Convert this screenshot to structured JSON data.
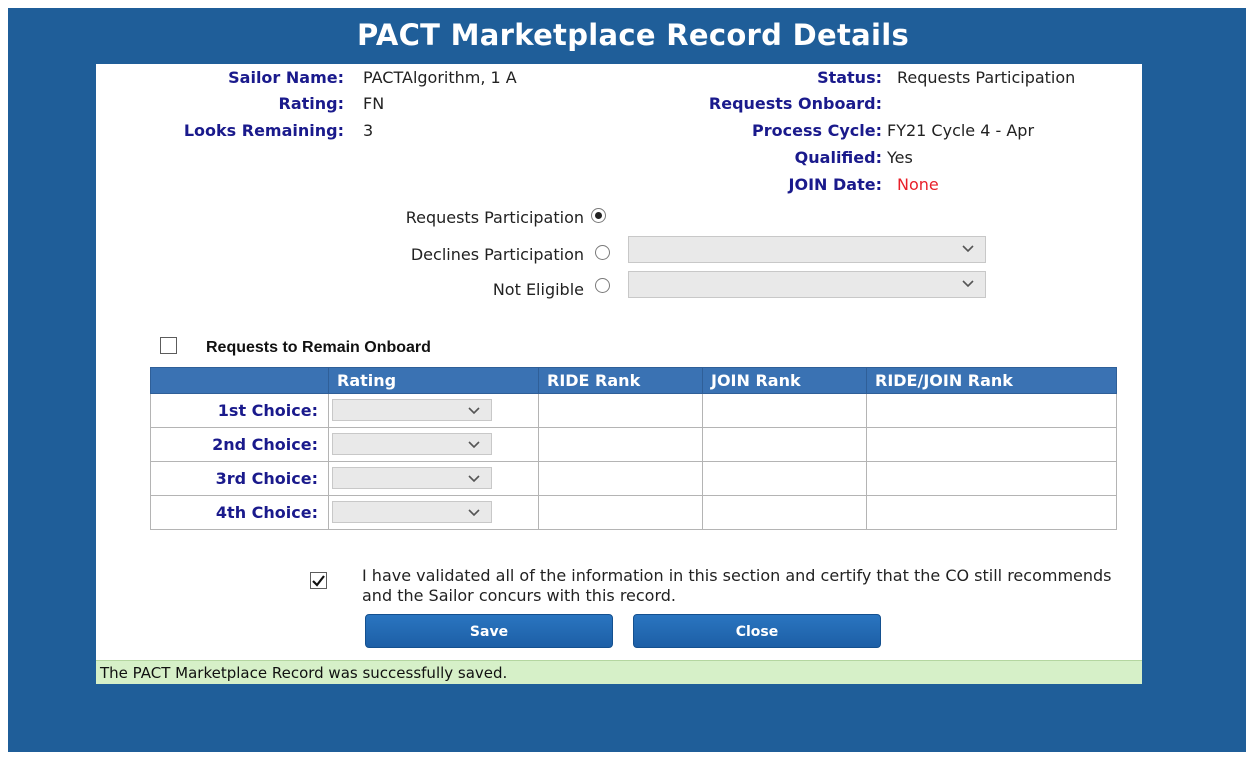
{
  "dialog": {
    "title": "PACT Marketplace Record Details"
  },
  "details": {
    "sailor_name_label": "Sailor Name:",
    "sailor_name": "PACTAlgorithm, 1 A",
    "rating_label": "Rating:",
    "rating": "FN",
    "looks_remaining_label": "Looks Remaining:",
    "looks_remaining": "3",
    "status_label": "Status:",
    "status": "Requests Participation",
    "requests_onboard_label": "Requests Onboard:",
    "requests_onboard": "",
    "process_cycle_label": "Process Cycle:",
    "process_cycle": "FY21 Cycle 4 - Apr",
    "qualified_label": "Qualified:",
    "qualified": "Yes",
    "join_date_label": "JOIN Date:",
    "join_date": "None",
    "join_date_color": "#e8202a"
  },
  "participation": {
    "options": [
      {
        "label": "Requests Participation",
        "selected": true
      },
      {
        "label": "Declines Participation",
        "selected": false
      },
      {
        "label": "Not Eligible",
        "selected": false
      }
    ]
  },
  "remain_onboard": {
    "label": "Requests to Remain Onboard",
    "checked": false
  },
  "choices_table": {
    "headers": [
      "",
      "Rating",
      "RIDE Rank",
      "JOIN Rank",
      "RIDE/JOIN Rank"
    ],
    "rows": [
      {
        "label": "1st Choice:"
      },
      {
        "label": "2nd Choice:"
      },
      {
        "label": "3rd Choice:"
      },
      {
        "label": "4th Choice:"
      }
    ]
  },
  "certification": {
    "checked": true,
    "text": "I have validated all of the information in this section and certify that the CO still recommends and the Sailor concurs with this record."
  },
  "buttons": {
    "save": "Save",
    "close": "Close"
  },
  "status_bar": {
    "message": "The PACT Marketplace Record was successfully saved."
  },
  "colors": {
    "frame": "#1f5e99",
    "header_blue": "#3a72b3",
    "label_navy": "#1a1a8c",
    "success_bg": "#d6f0c8"
  },
  "icons": {
    "dropdown": "chevron-down-icon",
    "check": "checkmark-icon"
  }
}
